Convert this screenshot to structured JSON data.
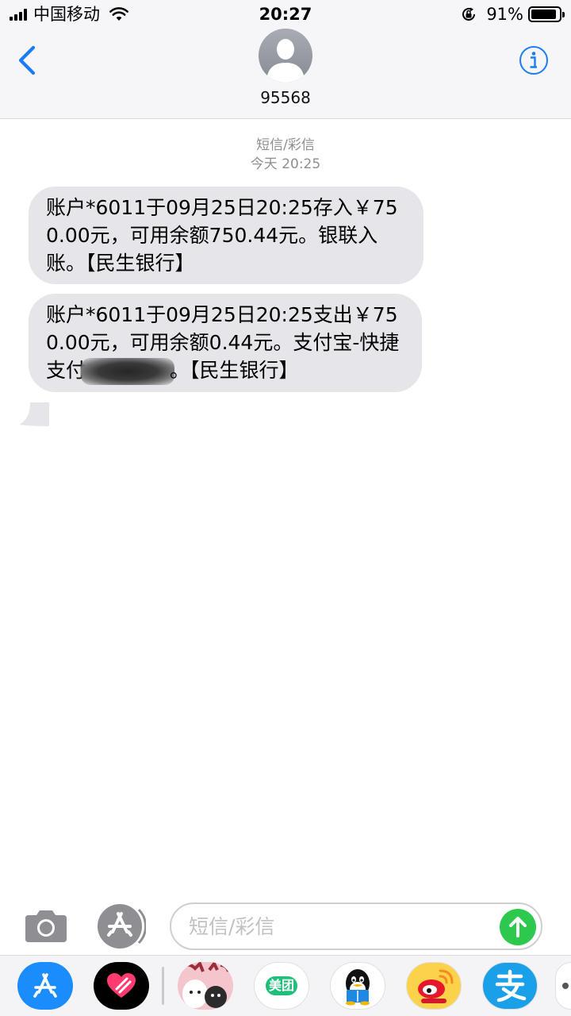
{
  "status_bar": {
    "carrier": "中国移动",
    "time": "20:27",
    "battery_percent": "91%",
    "battery_level": 0.91
  },
  "header": {
    "contact": "95568",
    "back_icon": "chevron-left-icon",
    "info_icon": "info-circle-icon"
  },
  "thread": {
    "service_label": "短信/彩信",
    "timestamp": "今天 20:25",
    "messages": [
      {
        "text": "账户*6011于09月25日20:25存入￥750.00元，可用余额750.44元。银联入账。【民生银行】"
      },
      {
        "text_before": "账户*6011于09月25日20:25支出￥750.00元，可用余额0.44元。支付宝-快捷支付",
        "text_after": "。【民生银行】"
      }
    ]
  },
  "compose": {
    "placeholder": "短信/彩信",
    "camera_icon": "camera-icon",
    "app_store_icon": "app-store-icon",
    "send_icon": "send-arrow-icon"
  },
  "app_drawer": {
    "meituan_label": "美团",
    "apps": [
      "App Store",
      "Digital Touch",
      "Stickers",
      "美团",
      "QQ",
      "微博",
      "支付宝"
    ]
  },
  "colors": {
    "accent": "#1b7cf7",
    "bubble": "#e5e5ea",
    "send": "#2dc94f",
    "meta_text": "#8e8e93"
  }
}
